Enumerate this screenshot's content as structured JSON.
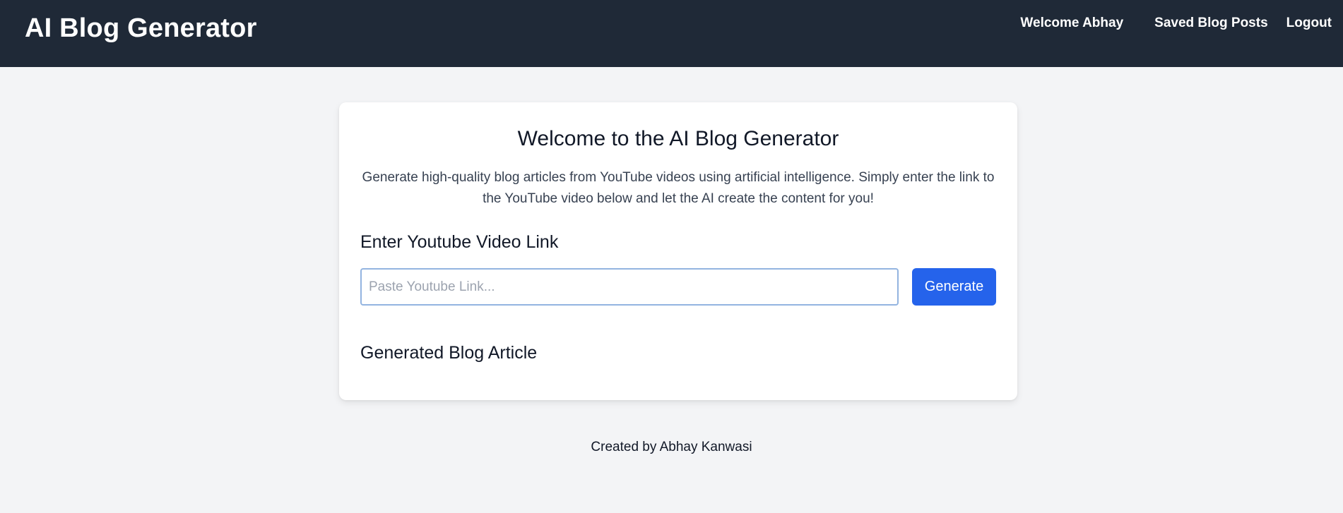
{
  "header": {
    "brand": "AI Blog Generator",
    "welcome_prefix": "Welcome",
    "username": "Abhay",
    "saved_posts_label": "Saved Blog Posts",
    "logout_label": "Logout"
  },
  "main": {
    "title": "Welcome to the AI Blog Generator",
    "description": "Generate high-quality blog articles from YouTube videos using artificial intelligence. Simply enter the link to the YouTube video below and let the AI create the content for you!",
    "link_section_label": "Enter Youtube Video Link",
    "link_input": {
      "value": "",
      "placeholder": "Paste Youtube Link..."
    },
    "generate_button_label": "Generate",
    "article_section_label": "Generated Blog Article",
    "article_content": ""
  },
  "footer": {
    "text": "Created by Abhay Kanwasi"
  },
  "colors": {
    "navbar_bg": "#1f2937",
    "page_bg": "#f3f4f6",
    "accent": "#2563eb"
  }
}
